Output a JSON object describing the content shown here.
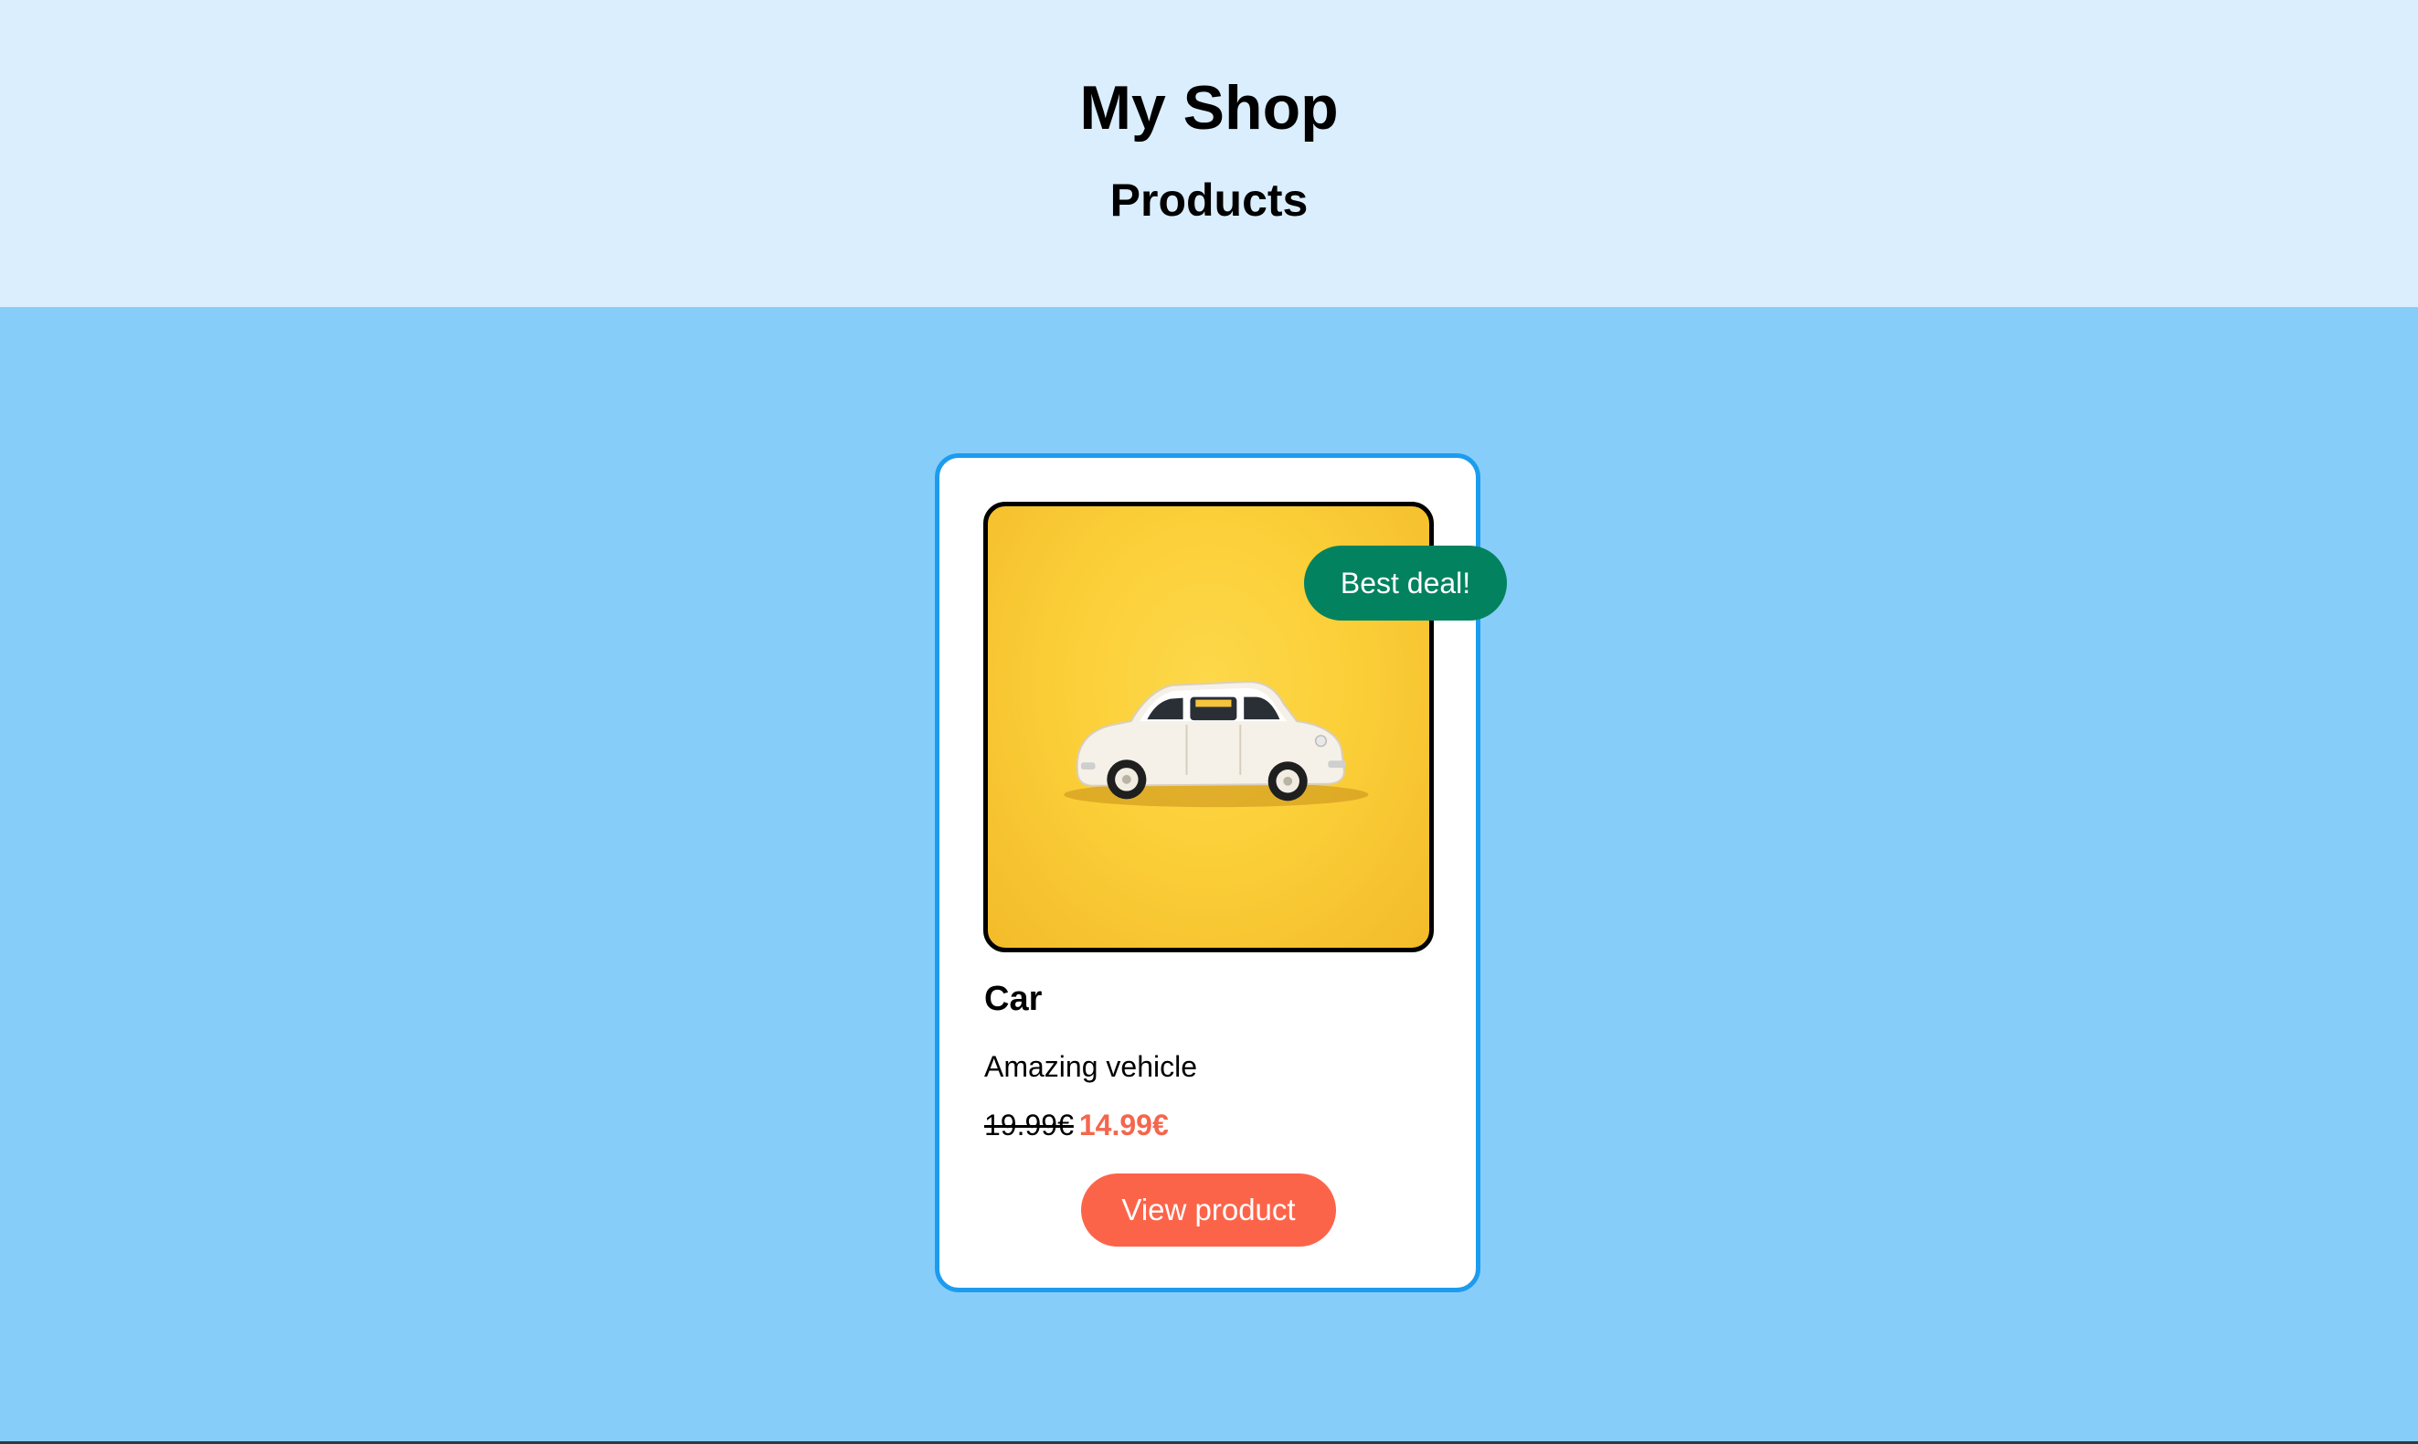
{
  "header": {
    "site_title": "My Shop",
    "section_title": "Products"
  },
  "product": {
    "name": "Car",
    "description": "Amazing vehicle",
    "old_price": "19.99€",
    "new_price": "14.99€",
    "badge": "Best deal!",
    "button_label": "View product",
    "image_subject": "toy-car-icon"
  },
  "colors": {
    "header_bg": "#dbeefe",
    "page_bg": "#87cdf9",
    "card_border": "#1c9cef",
    "badge_bg": "#03825f",
    "accent": "#fc644a",
    "image_bg": "#fbcf38"
  }
}
